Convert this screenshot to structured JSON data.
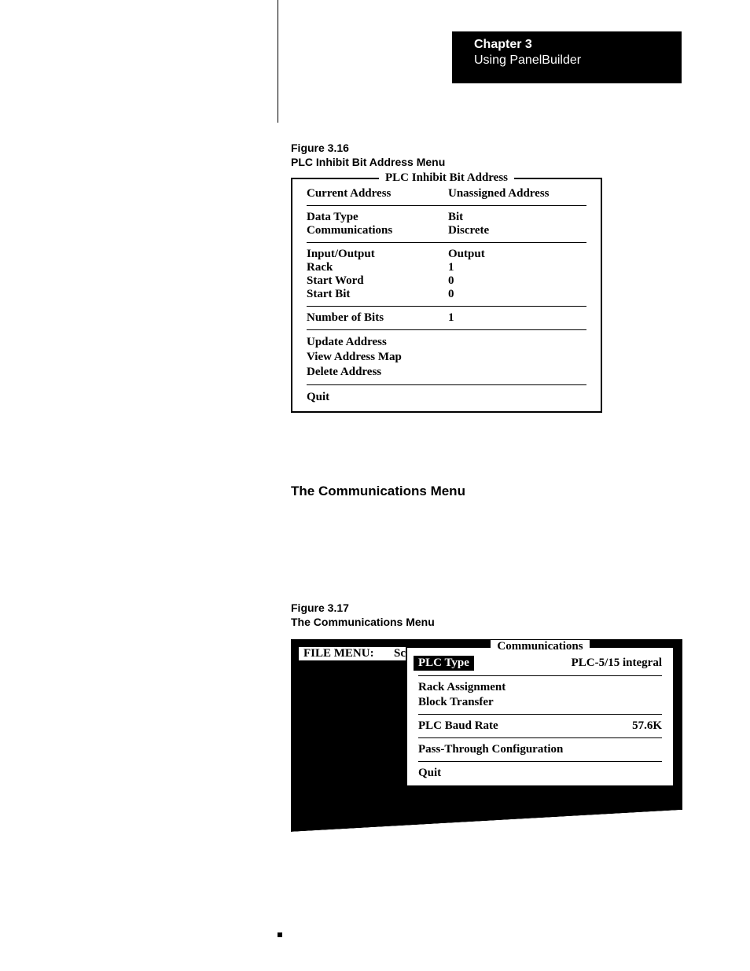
{
  "header": {
    "chapter": "Chapter 3",
    "subtitle": "Using PanelBuilder"
  },
  "figure1": {
    "label": "Figure 3.16",
    "title": "PLC Inhibit Bit Address Menu",
    "boxTitle": "PLC Inhibit Bit Address",
    "rows1": {
      "currentAddressLabel": "Current Address",
      "currentAddressValue": "Unassigned Address"
    },
    "rows2": {
      "dataTypeLabel": "Data Type",
      "dataTypeValue": "Bit",
      "commLabel": "Communications",
      "commValue": "Discrete"
    },
    "rows3": {
      "ioLabel": "Input/Output",
      "ioValue": "Output",
      "rackLabel": "Rack",
      "rackValue": "1",
      "startWordLabel": "Start Word",
      "startWordValue": "0",
      "startBitLabel": "Start Bit",
      "startBitValue": "0"
    },
    "rows4": {
      "numBitsLabel": "Number of Bits",
      "numBitsValue": "1"
    },
    "actions": {
      "update": "Update Address",
      "view": "View Address Map",
      "delete": "Delete Address"
    },
    "quit": "Quit"
  },
  "sectionTitle": "The Communications Menu",
  "figure2": {
    "label": "Figure 3.17",
    "title": "The Communications Menu",
    "fileMenuLabel": "FILE MENU:",
    "fileMenuSuffix": "Sc",
    "boxTitle": "Communications",
    "plcTypeLabel": "PLC Type",
    "plcTypeValue": "PLC-5/15 integral",
    "rackAssignment": "Rack Assignment",
    "blockTransfer": "Block Transfer",
    "baudLabel": "PLC Baud Rate",
    "baudValue": "57.6K",
    "passThrough": "Pass-Through Configuration",
    "quit": "Quit"
  }
}
